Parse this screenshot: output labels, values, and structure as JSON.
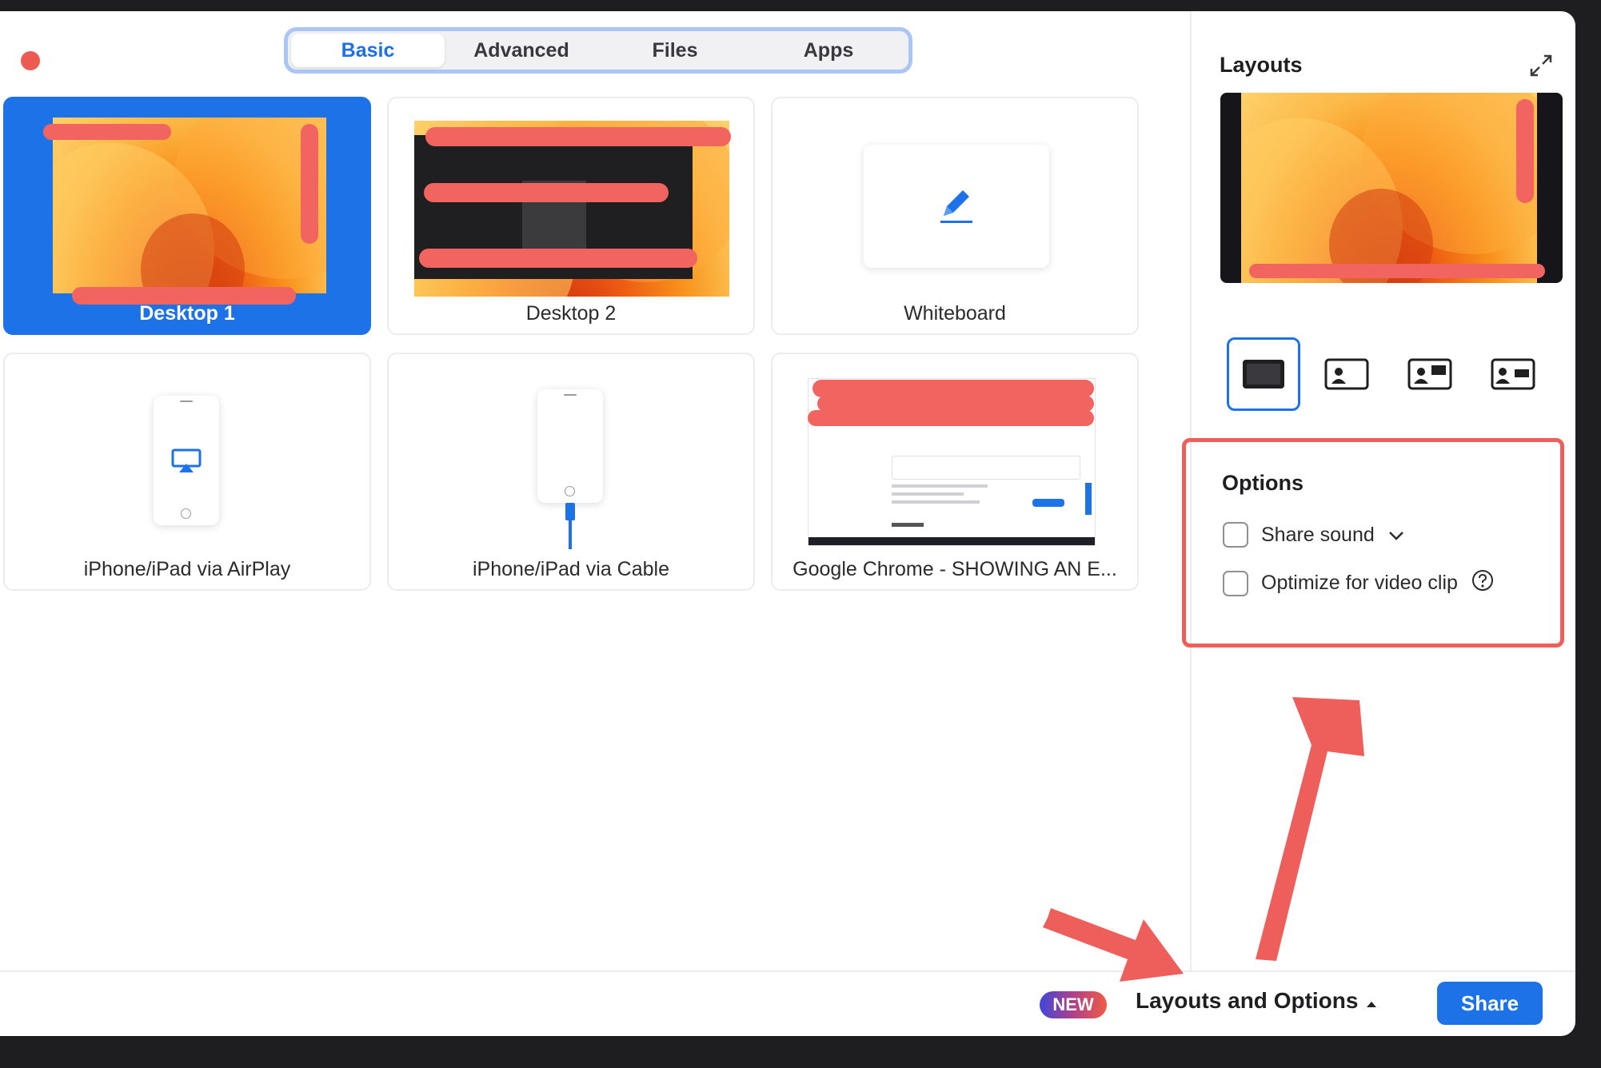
{
  "tabs": [
    "Basic",
    "Advanced",
    "Files",
    "Apps"
  ],
  "active_tab": "Basic",
  "sources": {
    "desktop1": "Desktop 1",
    "desktop2": "Desktop 2",
    "whiteboard": "Whiteboard",
    "airplay": "iPhone/iPad via AirPlay",
    "cable": "iPhone/iPad via Cable",
    "chrome": "Google Chrome - SHOWING AN E..."
  },
  "sidebar": {
    "layouts_title": "Layouts",
    "options_title": "Options",
    "share_sound": "Share sound",
    "optimize_video": "Optimize for video clip"
  },
  "bottombar": {
    "new_badge": "NEW",
    "layouts_and_options": "Layouts and Options",
    "share": "Share"
  },
  "colors": {
    "accent": "#1d72e8",
    "annotation": "#ee5f5c",
    "close_dot": "#ec5a52"
  },
  "icons": {
    "expand": "expand-icon",
    "whiteboard": "pencil-icon",
    "airplay": "airplay-icon",
    "help": "question-circle-icon",
    "dropdown": "chevron-down-icon",
    "caret": "caret-up-icon"
  }
}
